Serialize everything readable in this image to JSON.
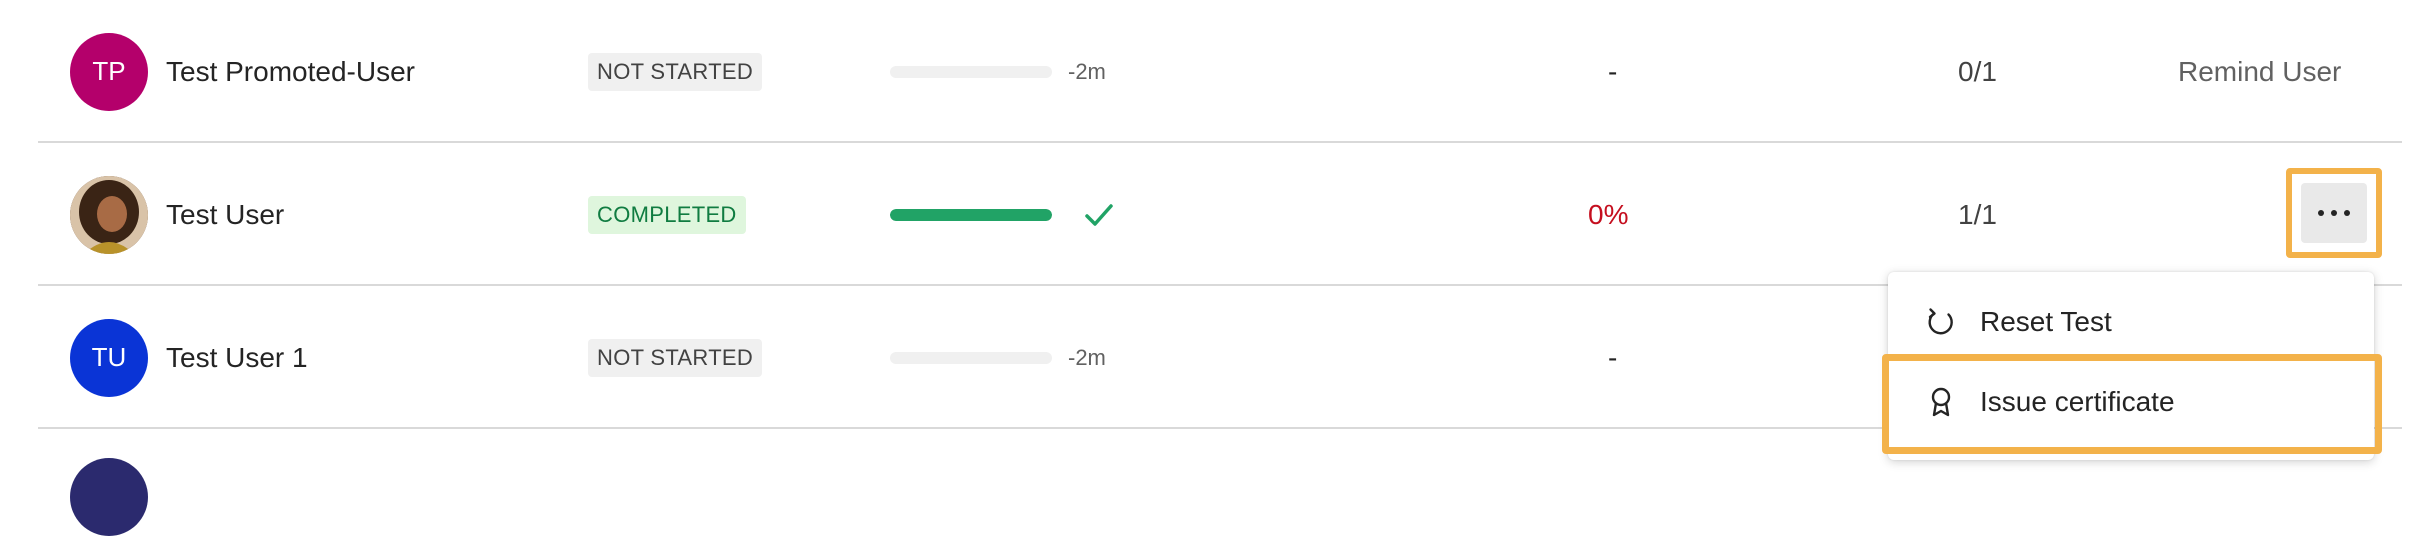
{
  "rows": [
    {
      "initials": "TP",
      "avatar_color": "#b4006b",
      "name": "Test Promoted-User",
      "status": "NOT STARTED",
      "progress_time": "-2m",
      "progress_value": 0,
      "score": "-",
      "attempts": "0/1",
      "action": "Remind User"
    },
    {
      "initials": "",
      "avatar_type": "photo",
      "name": "Test User",
      "status": "COMPLETED",
      "progress_value": 1,
      "score": "0%",
      "attempts": "1/1",
      "action_icon": "more-horizontal-icon"
    },
    {
      "initials": "TU",
      "avatar_color": "#0a34d6",
      "name": "Test User 1",
      "status": "NOT STARTED",
      "progress_time": "-2m",
      "progress_value": 0,
      "score": "-"
    }
  ],
  "context_menu": {
    "items": [
      {
        "label": "Reset Test",
        "icon": "reset-icon"
      },
      {
        "label": "Issue certificate",
        "icon": "certificate-icon"
      }
    ]
  },
  "colors": {
    "highlight": "#f3b24a",
    "progress_complete": "#21a366",
    "score_zero": "#c50f1f"
  }
}
